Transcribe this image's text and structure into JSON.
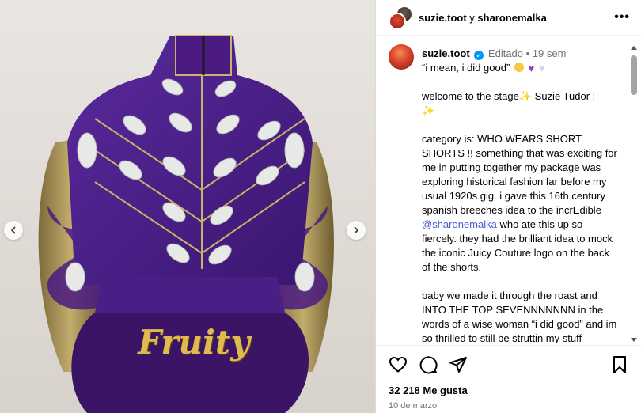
{
  "header": {
    "user1": "suzie.toot",
    "conjunction": " y ",
    "user2": "sharonemalka",
    "more": "•••"
  },
  "media": {
    "garment_text": "Fruity"
  },
  "caption": {
    "username": "suzie.toot",
    "verified_glyph": "✓",
    "separator": " • ",
    "edited": "Editado",
    "age": "19 sem",
    "quote": "“i mean, i did good”",
    "p1": "welcome to the stage",
    "p1b": " Suzie Tudor !",
    "sparkle": "✨",
    "p2": "category is: WHO WEARS SHORT SHORTS !! something that was exciting for me in putting together my package was exploring historical fashion far before my usual 1920s gig. i gave this 16th century spanish breeches idea to the incrEdible ",
    "mention": "@sharonemalka",
    "p2b": " who ate this up so fiercely. they had the brilliant idea to mock the iconic Juicy Couture logo on the back of the shorts.",
    "p3": "baby we made it through the roast and INTO THE TOP SEVENNNNNNN in the words of a wise woman “i did good” and im so thrilled to still be struttin my stuff"
  },
  "footer": {
    "likes": "32 218 Me gusta",
    "date": "10 de marzo"
  },
  "colors": {
    "verified": "#0095f6",
    "mention": "#4a5ccf",
    "velvet": "#4a1a80"
  }
}
